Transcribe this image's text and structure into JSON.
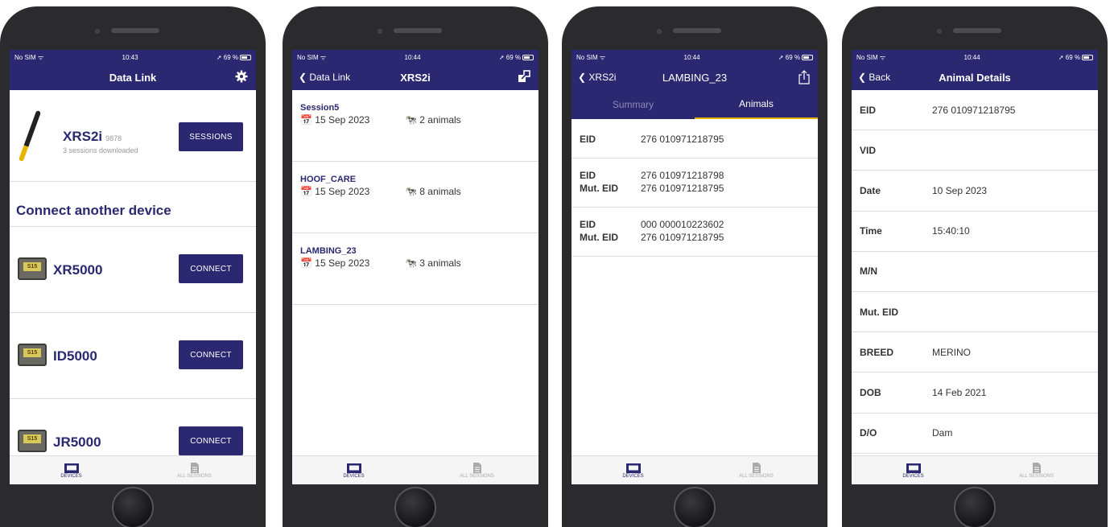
{
  "common": {
    "carrier": "No SIM",
    "battery": "69 %",
    "tab_devices": "DEVICES",
    "tab_all_sessions": "ALL SESSIONS",
    "accent_color": "#2a2870",
    "highlight_color": "#e8b400"
  },
  "screen1": {
    "time": "10:43",
    "title": "Data Link",
    "device_name": "XRS2i",
    "device_serial": "9878",
    "device_status": "3 sessions downloaded",
    "sessions_button": "SESSIONS",
    "section_title": "Connect another device",
    "readers": [
      {
        "name": "XR5000",
        "button": "CONNECT"
      },
      {
        "name": "ID5000",
        "button": "CONNECT"
      },
      {
        "name": "JR5000",
        "button": "CONNECT"
      }
    ],
    "reader_logo": "S15"
  },
  "screen2": {
    "time": "10:44",
    "back_label": "Data Link",
    "title": "XRS2i",
    "sessions": [
      {
        "name": "Session5",
        "date": "15 Sep 2023",
        "count": "2 animals"
      },
      {
        "name": "HOOF_CARE",
        "date": "15 Sep 2023",
        "count": "8 animals"
      },
      {
        "name": "LAMBING_23",
        "date": "15 Sep 2023",
        "count": "3 animals"
      }
    ]
  },
  "screen3": {
    "time": "10:44",
    "back_label": "XRS2i",
    "title": "LAMBING_23",
    "tab_summary": "Summary",
    "tab_animals": "Animals",
    "label_eid": "EID",
    "label_mut_eid": "Mut. EID",
    "animals": [
      {
        "eid": "276 010971218795",
        "mut_eid": ""
      },
      {
        "eid": "276 010971218798",
        "mut_eid": "276 010971218795"
      },
      {
        "eid": "000 000010223602",
        "mut_eid": "276 010971218795"
      }
    ]
  },
  "screen4": {
    "time": "10:44",
    "back_label": "Back",
    "title": "Animal Details",
    "fields": [
      {
        "label": "EID",
        "value": "276 010971218795"
      },
      {
        "label": "VID",
        "value": ""
      },
      {
        "label": "Date",
        "value": "10 Sep 2023"
      },
      {
        "label": "Time",
        "value": "15:40:10"
      },
      {
        "label": "M/N",
        "value": ""
      },
      {
        "label": "Mut. EID",
        "value": ""
      },
      {
        "label": "BREED",
        "value": "MERINO"
      },
      {
        "label": "DOB",
        "value": "14 Feb 2021"
      },
      {
        "label": "D/O",
        "value": "Dam"
      }
    ]
  }
}
